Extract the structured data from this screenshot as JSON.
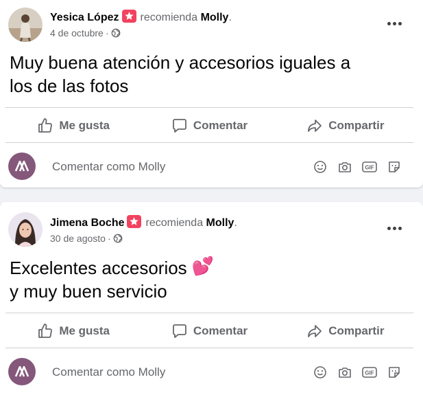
{
  "posts": [
    {
      "author": "Yesica López",
      "action": "recomienda",
      "page": "Molly",
      "date": "4 de octubre",
      "text_lines": [
        "Muy buena atención y accesorios iguales a",
        "los de las fotos"
      ],
      "emoji": ""
    },
    {
      "author": "Jimena Boche",
      "action": "recomienda",
      "page": "Molly",
      "date": "30 de agosto",
      "text_lines": [
        "Excelentes accesorios",
        "y muy buen servicio"
      ],
      "emoji": "💕"
    }
  ],
  "actions": {
    "like": "Me gusta",
    "comment": "Comentar",
    "share": "Compartir"
  },
  "comment_box": {
    "placeholder": "Comentar como Molly"
  },
  "icons": {
    "recommend_badge": "star-badge-icon",
    "privacy": "globe-icon",
    "more": "more-options-icon",
    "like": "thumbs-up-icon",
    "comment": "speech-bubble-icon",
    "share": "share-arrow-icon",
    "emoji": "smiley-icon",
    "camera": "camera-icon",
    "gif": "gif-icon",
    "sticker": "sticker-icon"
  },
  "colors": {
    "badge": "#f3425f",
    "avatar_brand": "#84577b",
    "secondary_text": "#65676b"
  }
}
